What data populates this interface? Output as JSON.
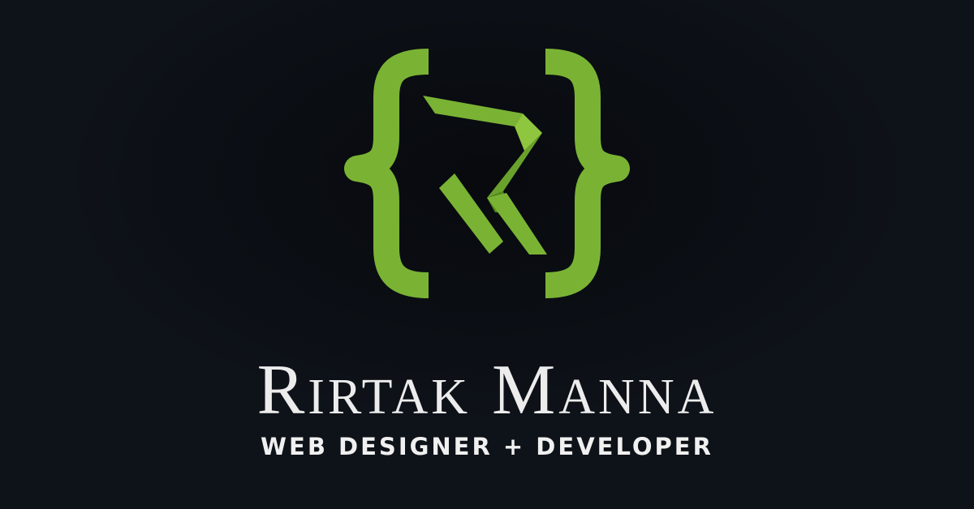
{
  "brand": {
    "name": "Rirtak Manna",
    "tagline": "WEB DESIGNER + DEVELOPER"
  },
  "logo": {
    "icon": "curly-braces-r-monogram",
    "letter": "R"
  },
  "colors": {
    "background": "#0c1016",
    "accent": "#7ab334",
    "accent_light": "#8fc63f",
    "accent_dark": "#4f8a1c",
    "text": "#ececec"
  }
}
